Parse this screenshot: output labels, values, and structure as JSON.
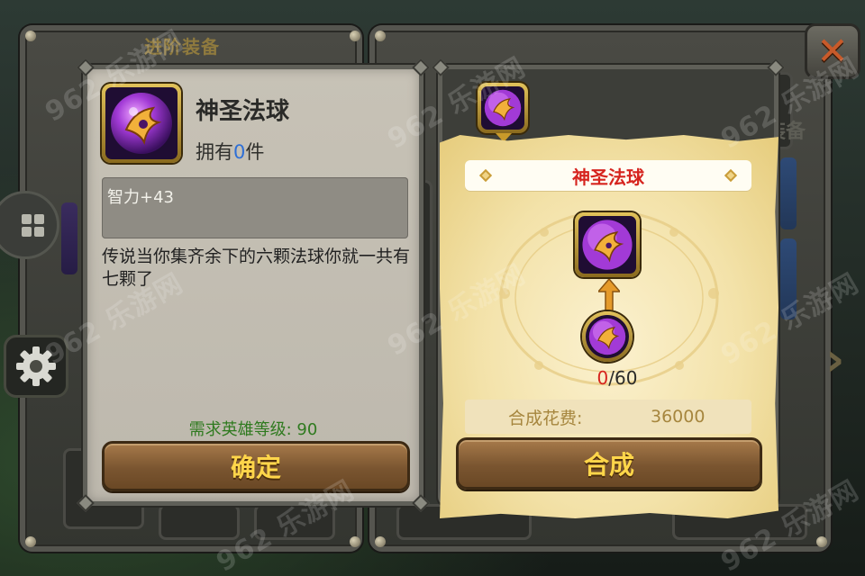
{
  "background": {
    "panel_title": "进阶装备",
    "tab_label": "装备",
    "watermark": "962 乐游网"
  },
  "item": {
    "name": "神圣法球",
    "owned_prefix": "拥有",
    "owned_count": "0",
    "owned_suffix": "件",
    "stat": "智力+43",
    "description": "传说当你集齐余下的六颗法球你就一共有七颗了",
    "required_level": "需求英雄等级: 90",
    "confirm_label": "确定"
  },
  "craft": {
    "recipe_title": "神圣法球",
    "progress_current": "0",
    "progress_total": "/60",
    "cost_label": "合成花费:",
    "cost_value": "36000",
    "craft_label": "合成"
  },
  "colors": {
    "title_red": "#d6241e",
    "button_text": "#ffd64a",
    "level_green": "#2f7a1f",
    "count_blue": "#2e6fd6"
  },
  "icons": {
    "orb": "holy-orb-icon",
    "close": "close-icon",
    "settings": "gear-icon",
    "menu": "grid-menu-icon",
    "next": "chevron-right-icon"
  }
}
